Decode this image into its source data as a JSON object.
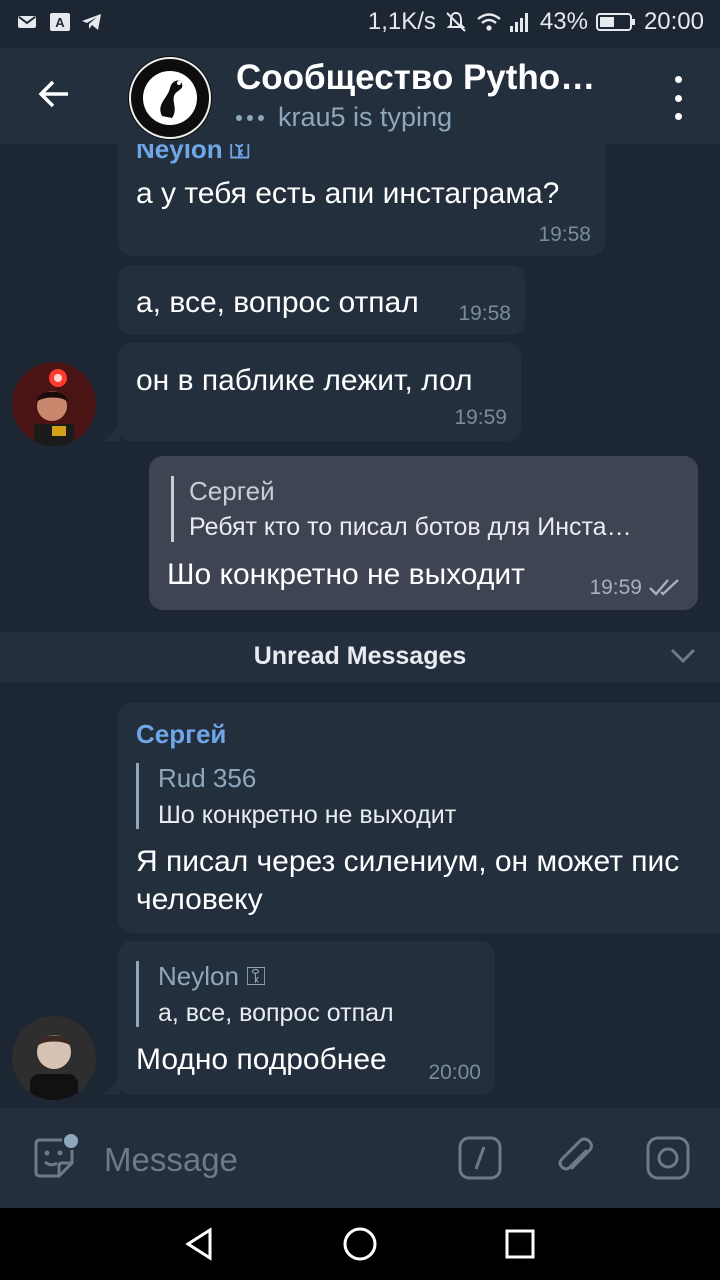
{
  "status_bar": {
    "speed": "1,1K/s",
    "battery_percent": "43%",
    "time": "20:00"
  },
  "header": {
    "title": "Сообщество Python…",
    "typing": "krau5 is typing"
  },
  "messages": [
    {
      "sender": "Neylon ⚿",
      "text": "а у тебя есть апи инстаграма?",
      "time": "19:58"
    },
    {
      "text": "а, все, вопрос отпал",
      "time": "19:58"
    },
    {
      "text": "он в паблике лежит, лол",
      "time": "19:59"
    },
    {
      "reply_name": "Сергей",
      "reply_text": "Ребят кто то писал ботов для Инста…",
      "text": "Шо конкретно не выходит",
      "time": "19:59"
    },
    {
      "sender": "Сергей",
      "reply_name": "Rud 356",
      "reply_text": "Шо конкретно не выходит",
      "text_line1": "Я писал через силениум, он может пис",
      "text_line2": "человеку"
    },
    {
      "reply_name": "Neylon ⚿",
      "reply_text": "а, все, вопрос отпал",
      "text": "Модно подробнее",
      "time": "20:00"
    }
  ],
  "unread_label": "Unread Messages",
  "input": {
    "placeholder": "Message"
  },
  "colors": {
    "background": "#1d2733",
    "bubble_incoming": "#242f3d",
    "bubble_outgoing": "#3e4452",
    "accent": "#6fa6e8"
  },
  "icons": [
    "mail-icon",
    "translate-icon",
    "telegram-icon",
    "mute-icon",
    "wifi-icon",
    "signal-icon",
    "battery-icon",
    "back-arrow-icon",
    "more-vert-icon",
    "read-checks-icon",
    "chevron-down-icon",
    "sticker-icon",
    "bot-command-icon",
    "attach-icon",
    "camera-icon",
    "nav-back-icon",
    "nav-home-icon",
    "nav-recents-icon"
  ]
}
